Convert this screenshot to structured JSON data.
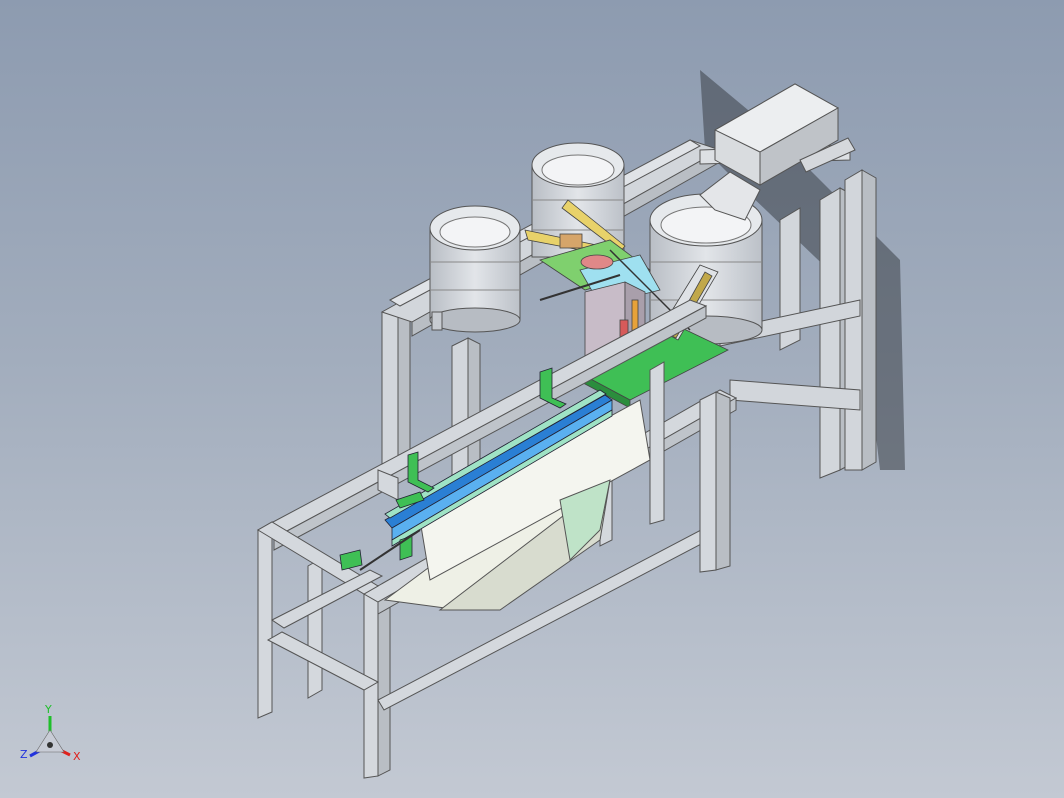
{
  "window": {
    "title": ""
  },
  "triad": {
    "x_label": "X",
    "y_label": "Y",
    "z_label": "Z",
    "colors": {
      "x": "#e0201c",
      "y": "#1fbf2a",
      "z": "#2233dd"
    }
  },
  "colors": {
    "background_top": "#8d9bb0",
    "background_bottom": "#c3c9d3",
    "frame": "#cfd3d8",
    "bowl": "#d7dbe0",
    "accent_green": "#3fbf55",
    "accent_blue": "#2a7fd4"
  }
}
